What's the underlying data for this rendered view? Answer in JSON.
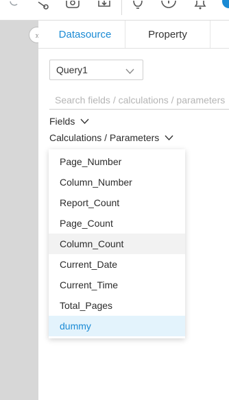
{
  "tabs": [
    {
      "label": "Datasource",
      "active": true
    },
    {
      "label": "Property",
      "active": false
    }
  ],
  "datasource": {
    "query_select": "Query1",
    "search_placeholder": "Search fields / calculations / parameters"
  },
  "sections": {
    "fields_label": "Fields",
    "calc_label": "Calculations / Parameters"
  },
  "dropdown": {
    "items": [
      {
        "label": "Page_Number",
        "state": "normal"
      },
      {
        "label": "Column_Number",
        "state": "normal"
      },
      {
        "label": "Report_Count",
        "state": "normal"
      },
      {
        "label": "Page_Count",
        "state": "normal"
      },
      {
        "label": "Column_Count",
        "state": "hover"
      },
      {
        "label": "Current_Date",
        "state": "normal"
      },
      {
        "label": "Current_Time",
        "state": "normal"
      },
      {
        "label": "Total_Pages",
        "state": "normal"
      },
      {
        "label": "dummy",
        "state": "selected"
      }
    ]
  },
  "toolbar_icons": [
    "share-icon",
    "camera-icon",
    "export-icon",
    "lightbulb-icon",
    "info-icon",
    "bell-icon"
  ],
  "colors": {
    "accent": "#1a8ad4",
    "selected_bg": "#e3f3fc",
    "hover_bg": "#f2f2f2",
    "gutter": "#d7d7d7"
  }
}
